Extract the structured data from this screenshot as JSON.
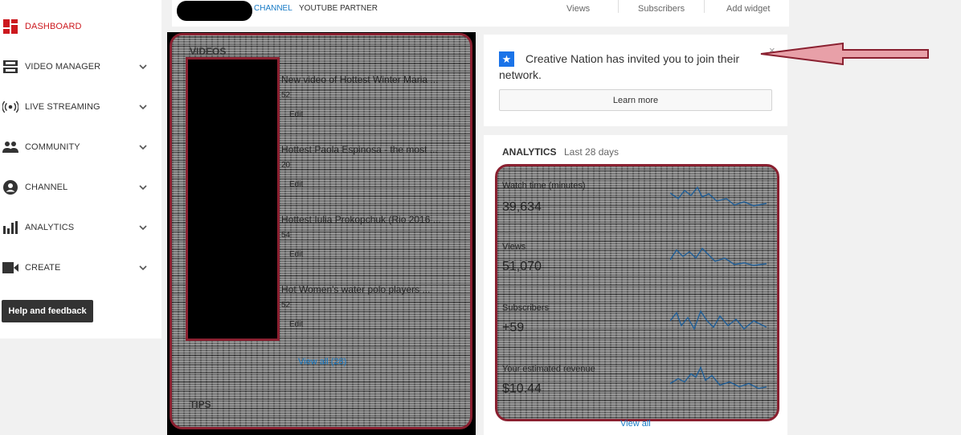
{
  "sidebar": {
    "items": [
      {
        "label": "DASHBOARD",
        "icon": "dashboard-icon",
        "active": true
      },
      {
        "label": "VIDEO MANAGER",
        "icon": "video-manager-icon"
      },
      {
        "label": "LIVE STREAMING",
        "icon": "live-streaming-icon"
      },
      {
        "label": "COMMUNITY",
        "icon": "community-icon"
      },
      {
        "label": "CHANNEL",
        "icon": "channel-icon"
      },
      {
        "label": "ANALYTICS",
        "icon": "analytics-icon"
      },
      {
        "label": "CREATE",
        "icon": "create-icon"
      }
    ],
    "help_label": "Help and feedback"
  },
  "topbar": {
    "channel_label": "CHANNEL",
    "partner_label": "YOUTUBE PARTNER",
    "views_label": "Views",
    "subscribers_label": "Subscribers",
    "add_widget_label": "Add widget"
  },
  "videos": {
    "title": "VIDEOS",
    "items": [
      {
        "title": "New video of Hottest Winter Maria ...",
        "meta": "52",
        "edit": "Edit"
      },
      {
        "title": "Hottest Paola Espinosa - the most ...",
        "meta": "20",
        "edit": "Edit"
      },
      {
        "title": "Hottest Iulia Prokopchuk (Rio 2016 ...",
        "meta": "54",
        "edit": "Edit"
      },
      {
        "title": "Hot Women's water polo players ...",
        "meta": "52",
        "edit": "Edit"
      }
    ],
    "view_all": "View all (28)",
    "tips_title": "TIPS"
  },
  "notice": {
    "text": "Creative Nation has invited you to join their network.",
    "learn_more": "Learn more",
    "close": "×"
  },
  "analytics": {
    "title": "ANALYTICS",
    "period": "Last 28 days",
    "metrics": [
      {
        "label": "Watch time (minutes)",
        "value": "39,634"
      },
      {
        "label": "Views",
        "value": "51,070"
      },
      {
        "label": "Subscribers",
        "value": "+59"
      },
      {
        "label": "Your estimated revenue",
        "value": "$10.44"
      }
    ],
    "view_all": "View all"
  },
  "colors": {
    "accent_red": "#cc181e",
    "link_blue": "#167ac6",
    "highlight_border": "#8a2030",
    "spark_blue": "#1f5f99"
  }
}
